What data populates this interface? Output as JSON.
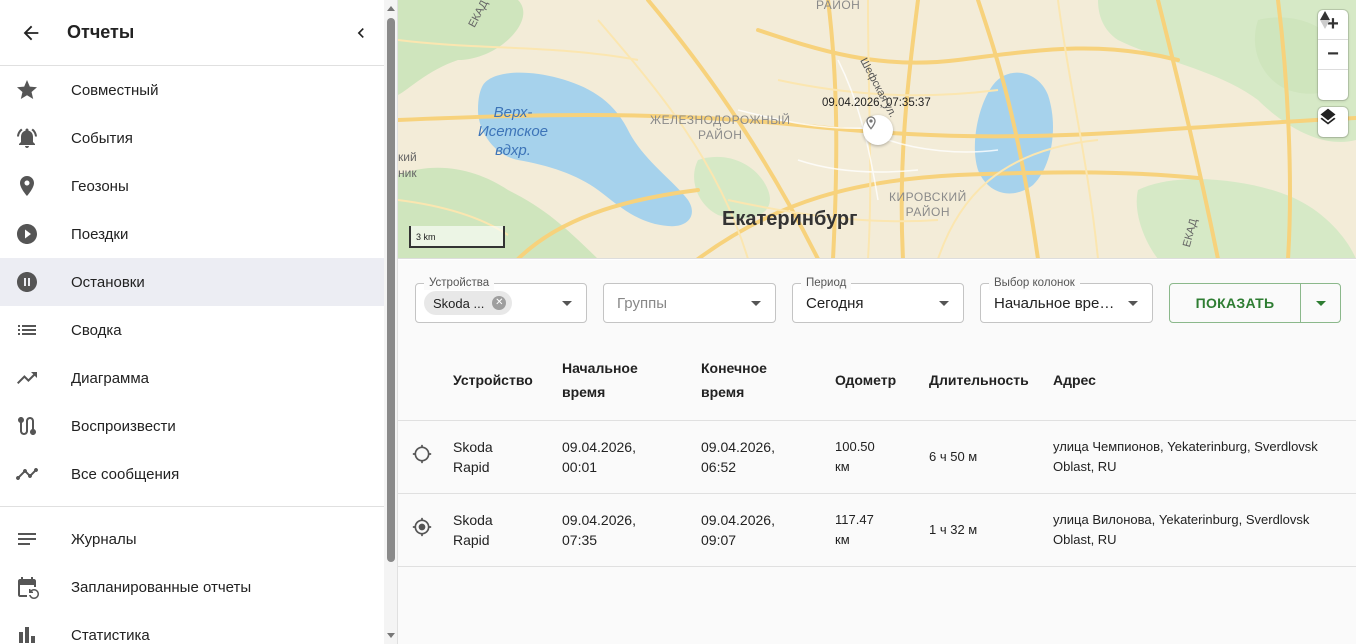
{
  "sidebar": {
    "title": "Отчеты",
    "items": [
      {
        "label": "Совместный",
        "icon": "star-icon"
      },
      {
        "label": "События",
        "icon": "bell-icon"
      },
      {
        "label": "Геозоны",
        "icon": "place-icon"
      },
      {
        "label": "Поездки",
        "icon": "play-circle-icon"
      },
      {
        "label": "Остановки",
        "icon": "pause-circle-icon",
        "active": true
      },
      {
        "label": "Сводка",
        "icon": "list-icon"
      },
      {
        "label": "Диаграмма",
        "icon": "trending-up-icon"
      },
      {
        "label": "Воспроизвести",
        "icon": "route-icon"
      },
      {
        "label": "Все сообщения",
        "icon": "timeline-icon"
      }
    ],
    "items2": [
      {
        "label": "Журналы",
        "icon": "notes-icon"
      },
      {
        "label": "Запланированные отчеты",
        "icon": "event-repeat-icon"
      },
      {
        "label": "Статистика",
        "icon": "bar-chart-icon"
      }
    ]
  },
  "map": {
    "labels": {
      "district_top": "РАЙОН",
      "lake": "Верх-\nИсетское\nвдхр.",
      "zh_district": "ЖЕЛЕЗНОДОРОЖНЫЙ\nРАЙОН",
      "kirov_district": "КИРОВСКИЙ\nРАЙОН",
      "city": "Екатеринбург",
      "left_cut": "кий\nник",
      "street": "Шефская ул.",
      "ekad_top": "ЕКАД",
      "ekad_right": "ЕКАД"
    },
    "scale": "3 km",
    "marker_time": "09.04.2026, 07:35:37",
    "controls": {
      "zoom_in": "+",
      "zoom_out": "−"
    }
  },
  "filters": {
    "device": {
      "legend": "Устройства",
      "chip": "Skoda ..."
    },
    "groups": {
      "placeholder": "Группы"
    },
    "period": {
      "legend": "Период",
      "value": "Сегодня"
    },
    "columns": {
      "legend": "Выбор колонок",
      "value": "Начальное время"
    },
    "show_label": "ПОКАЗАТЬ"
  },
  "table": {
    "headers": {
      "device": "Устройство",
      "start_l1": "Начальное",
      "start_l2": "время",
      "end_l1": "Конечное",
      "end_l2": "время",
      "odometer": "Одометр",
      "duration": "Длительность",
      "address": "Адрес"
    },
    "rows": [
      {
        "device_l1": "Skoda",
        "device_l2": "Rapid",
        "start_l1": "09.04.2026,",
        "start_l2": "00:01",
        "end_l1": "09.04.2026,",
        "end_l2": "06:52",
        "odo_l1": "100.50",
        "odo_l2": "км",
        "duration": "6 ч 50 м",
        "address": "улица Чемпионов, Yekaterinburg, Sverdlovsk Oblast, RU",
        "icon": "gps-not-fixed-icon"
      },
      {
        "device_l1": "Skoda",
        "device_l2": "Rapid",
        "start_l1": "09.04.2026,",
        "start_l2": "07:35",
        "end_l1": "09.04.2026,",
        "end_l2": "09:07",
        "odo_l1": "117.47",
        "odo_l2": "км",
        "duration": "1 ч 32 м",
        "address": "улица Вилонова, Yekaterinburg, Sverdlovsk Oblast, RU",
        "icon": "gps-fixed-icon"
      }
    ]
  }
}
